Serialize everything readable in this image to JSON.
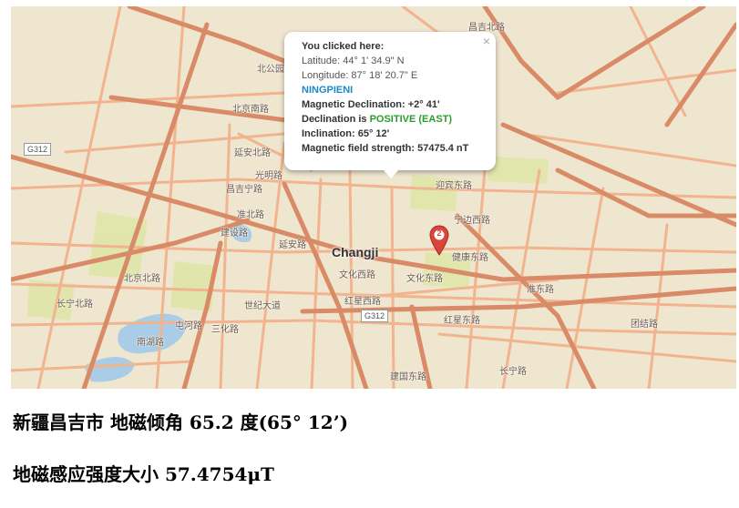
{
  "map": {
    "city_label": "Changji",
    "highway_shield": "G312",
    "marker_number": "2",
    "road_labels": [
      "北京南路",
      "延安北路",
      "光明路",
      "昌吉宁路",
      "延安路",
      "建设路",
      "文化西路",
      "文化东路",
      "红星西路",
      "红星东路",
      "建国东路",
      "迎宾东路",
      "健康东路",
      "宁边西路",
      "准东路",
      "准北路",
      "屯河路",
      "南湖路",
      "北京北路",
      "三化路",
      "长宁北路",
      "世纪大道",
      "昌吉北路",
      "团结路",
      "北公园路",
      "长宁路"
    ]
  },
  "popup": {
    "title": "You clicked here:",
    "latitude": "Latitude: 44° 1' 34.9\" N",
    "longitude": "Longitude: 87° 18' 20.7\" E",
    "model": "NINGPIENI",
    "declination": "Magnetic Declination: +2° 41'",
    "declination_prefix": "Declination is ",
    "declination_sign": "POSITIVE (EAST)",
    "inclination": "Inclination: 65° 12'",
    "field_strength": "Magnetic field strength: 57475.4 nT",
    "close": "×"
  },
  "captions": {
    "line1": "新疆昌吉市  地磁倾角 65.2 度(65°  12’)",
    "line2": "地磁感应强度大小 57.4754μT"
  },
  "colors": {
    "map_bg": "#efe6cf",
    "major_road": "#d98a66",
    "minor_road": "#f2b48f",
    "park": "#dfe6a8",
    "water": "#a9cde6",
    "popup_model": "#1e88c8",
    "popup_positive": "#2a9d2a",
    "marker": "#d9453b"
  }
}
